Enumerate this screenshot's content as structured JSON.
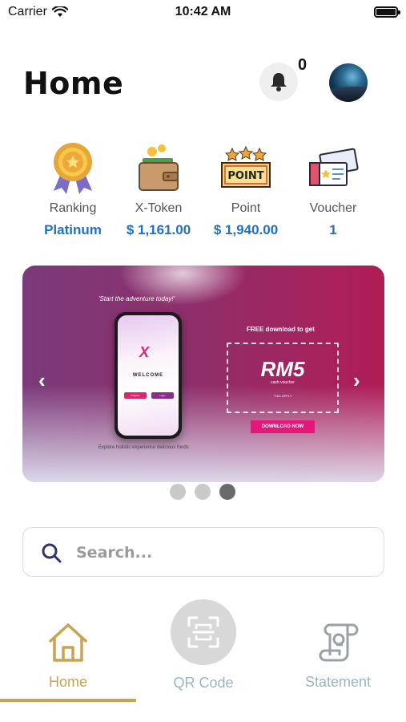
{
  "status_bar": {
    "carrier": "Carrier",
    "time": "10:42 AM"
  },
  "header": {
    "title": "Home",
    "notification_count": "0"
  },
  "stats": [
    {
      "icon": "ribbon-medal-icon",
      "label": "Ranking",
      "value": "Platinum"
    },
    {
      "icon": "wallet-icon",
      "label": "X-Token",
      "value": "$ 1,161.00"
    },
    {
      "icon": "point-sign-icon",
      "label": "Point",
      "value": "$ 1,940.00"
    },
    {
      "icon": "voucher-tickets-icon",
      "label": "Voucher",
      "value": "1"
    }
  ],
  "banner": {
    "tagline": "'Start the adventure today!'",
    "phone_logo": "X",
    "phone_welcome": "WELCOME",
    "phone_btn1": "Register",
    "phone_btn2": "Login",
    "free_text": "FREE download to get",
    "voucher_amount": "RM5",
    "voucher_sub": "cash voucher",
    "tc": "*T&C APPLY",
    "download": "DOWNLOAD NOW",
    "explore": "Explore holistic experience delicious foods",
    "prev": "‹",
    "next": "›",
    "slides": 3,
    "active_slide": 3
  },
  "search": {
    "placeholder": "Search..."
  },
  "bottom_nav": {
    "home": "Home",
    "qr": "QR Code",
    "statement": "Statement",
    "active": "Home"
  },
  "colors": {
    "accent_gold": "#c8a351",
    "value_blue": "#1f6fc4",
    "inactive_nav": "#9eb4c3"
  }
}
